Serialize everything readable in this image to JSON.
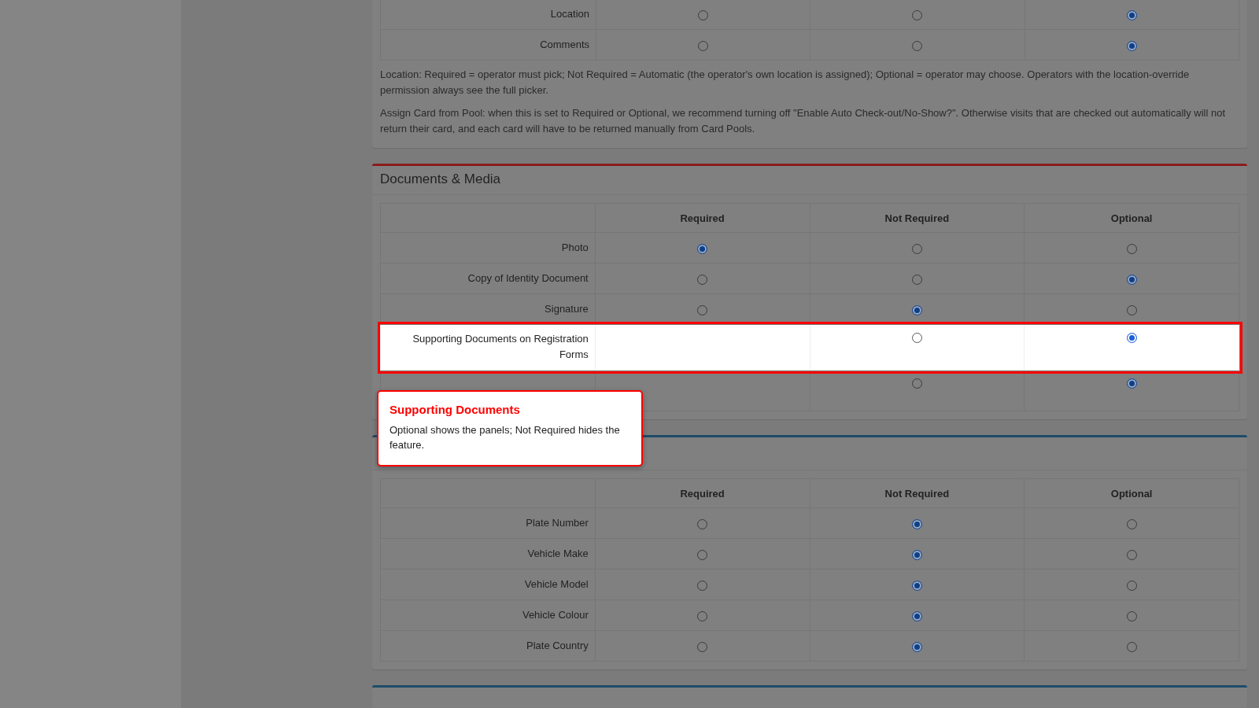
{
  "sections": [
    {
      "kind": "continued",
      "rows": [
        {
          "label": "Location",
          "highlighted": false,
          "options": [
            {
              "kind": "radio",
              "selected": false
            },
            {
              "kind": "radio",
              "selected": false
            },
            {
              "kind": "radio",
              "selected": true
            }
          ]
        },
        {
          "label": "Comments",
          "highlighted": false,
          "options": [
            {
              "kind": "radio",
              "selected": false
            },
            {
              "kind": "radio",
              "selected": false
            },
            {
              "kind": "radio",
              "selected": true
            }
          ]
        }
      ],
      "notes": [
        "Location: Required = operator must pick; Not Required = Automatic (the operator's own location is assigned); Optional = operator may choose. Operators with the location-override permission always see the full picker.",
        "Assign Card from Pool: when this is set to Required or Optional, we recommend turning off \"Enable Auto Check-out/No-Show?\". Otherwise visits that are checked out automatically will not return their card, and each card will have to be returned manually from Card Pools."
      ]
    },
    {
      "kind": "titled",
      "title": "Documents & Media",
      "color": "#8a1c1c",
      "columns": [
        "Required",
        "Not Required",
        "Optional"
      ],
      "rows": [
        {
          "label": "Photo",
          "highlighted": false,
          "options": [
            {
              "kind": "radio",
              "selected": true
            },
            {
              "kind": "radio",
              "selected": false
            },
            {
              "kind": "radio",
              "selected": false
            }
          ]
        },
        {
          "label": "Copy of Identity Document",
          "highlighted": false,
          "options": [
            {
              "kind": "radio",
              "selected": false
            },
            {
              "kind": "radio",
              "selected": false
            },
            {
              "kind": "radio",
              "selected": true
            }
          ]
        },
        {
          "label": "Signature",
          "highlighted": false,
          "options": [
            {
              "kind": "radio",
              "selected": false
            },
            {
              "kind": "radio",
              "selected": true
            },
            {
              "kind": "radio",
              "selected": false
            }
          ]
        },
        {
          "label": "Supporting Documents on Registration Forms",
          "highlighted": true,
          "options": [
            {
              "kind": "blank"
            },
            {
              "kind": "radio",
              "selected": false
            },
            {
              "kind": "radio",
              "selected": true
            }
          ]
        },
        {
          "highlighted": false,
          "options": [
            {
              "kind": "blank"
            },
            {
              "kind": "radio",
              "selected": false
            },
            {
              "kind": "radio",
              "selected": true
            }
          ]
        }
      ]
    },
    {
      "kind": "untitled",
      "color": "#1e4c6b",
      "columns": [
        "Required",
        "Not Required",
        "Optional"
      ],
      "rows": [
        {
          "label": "Plate Number",
          "highlighted": false,
          "options": [
            {
              "kind": "radio",
              "selected": false
            },
            {
              "kind": "radio",
              "selected": true
            },
            {
              "kind": "radio",
              "selected": false
            }
          ]
        },
        {
          "label": "Vehicle Make",
          "highlighted": false,
          "options": [
            {
              "kind": "radio",
              "selected": false
            },
            {
              "kind": "radio",
              "selected": true
            },
            {
              "kind": "radio",
              "selected": false
            }
          ]
        },
        {
          "label": "Vehicle Model",
          "highlighted": false,
          "options": [
            {
              "kind": "radio",
              "selected": false
            },
            {
              "kind": "radio",
              "selected": true
            },
            {
              "kind": "radio",
              "selected": false
            }
          ]
        },
        {
          "label": "Vehicle Colour",
          "highlighted": false,
          "options": [
            {
              "kind": "radio",
              "selected": false
            },
            {
              "kind": "radio",
              "selected": true
            },
            {
              "kind": "radio",
              "selected": false
            }
          ]
        },
        {
          "label": "Plate Country",
          "highlighted": false,
          "options": [
            {
              "kind": "radio",
              "selected": false
            },
            {
              "kind": "radio",
              "selected": true
            },
            {
              "kind": "radio",
              "selected": false
            }
          ]
        }
      ]
    },
    {
      "kind": "cut",
      "color": "#1e4c6b"
    }
  ],
  "tooltip": {
    "title": "Supporting Documents",
    "text": "Optional shows the panels; Not Required hides the feature."
  }
}
